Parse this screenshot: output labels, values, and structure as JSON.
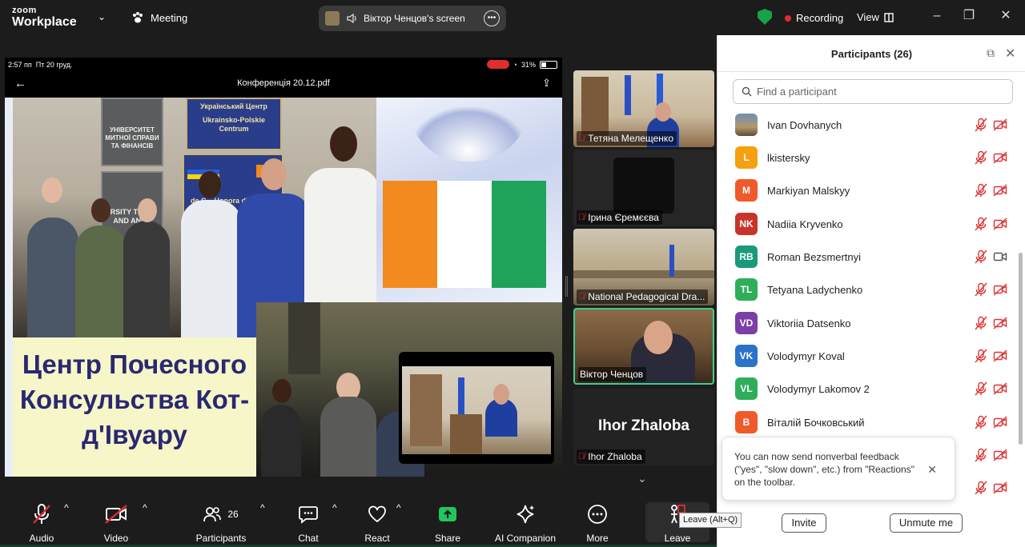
{
  "app": {
    "logo_line1": "zoom",
    "logo_line2": "Workplace",
    "meeting_label": "Meeting",
    "share_label": "Віктор Ченцов's screen",
    "recording_label": "Recording",
    "view_label": "View"
  },
  "shared_screen": {
    "status_time": "2:57 пп",
    "status_date": "Пт 20 груд.",
    "battery": "31%",
    "pdf_title": "Конференція 20.12.pdf",
    "plaque_line1": "Український Центр",
    "plaque_line2": "Ukrainsko-Polskie Centrum",
    "plaque_ua": "УНІВЕРСИТЕТ МИТНОЇ СПРАВИ ТА ФІНАНСІВ",
    "plaque_en": "RSITY TOMS AND ANCE",
    "plaque_honor": "de C... Honora d'Ivoire",
    "slide_text": "Центр Почесного Консульства Кот-д'Івуару",
    "flag_colors": [
      "#f28a1e",
      "#ffffff",
      "#1fa35a"
    ]
  },
  "video_tiles": [
    {
      "name": "Тетяна Мелещенко",
      "muted": true
    },
    {
      "name": "Ірина Єремєєва",
      "muted": true
    },
    {
      "name": "National Pedagogical Dra...",
      "muted": true
    },
    {
      "name": "Віктор Ченцов",
      "muted": false,
      "active": true
    },
    {
      "name": "Ihor Zhaloba",
      "muted": true,
      "camera_off": true
    }
  ],
  "participants_panel": {
    "title": "Participants (26)",
    "search_placeholder": "Find a participant",
    "participants": [
      {
        "name": "Ivan Dovhanych",
        "initials": "",
        "color": "photo",
        "cam_on": false
      },
      {
        "name": "lkistersky",
        "initials": "L",
        "color": "#f5a010",
        "cam_on": false
      },
      {
        "name": "Markiyan Malskyy",
        "initials": "M",
        "color": "#ef5a2a",
        "cam_on": false
      },
      {
        "name": "Nadiia Kryvenko",
        "initials": "NK",
        "color": "#c8342b",
        "cam_on": false
      },
      {
        "name": "Roman Bezsmertnyi",
        "initials": "RB",
        "color": "#1a9a7a",
        "cam_on": true
      },
      {
        "name": "Tetyana Ladychenko",
        "initials": "TL",
        "color": "#2fae5a",
        "cam_on": false
      },
      {
        "name": "Viktoriia Datsenko",
        "initials": "VD",
        "color": "#7b3fa8",
        "cam_on": false
      },
      {
        "name": "Volodymyr Koval",
        "initials": "VK",
        "color": "#2b72c9",
        "cam_on": false
      },
      {
        "name": "Volodymyr Lakomov 2",
        "initials": "VL",
        "color": "#2fae5a",
        "cam_on": false
      },
      {
        "name": "Віталій Бочковський",
        "initials": "B",
        "color": "#ef5a2a",
        "cam_on": false
      },
      {
        "name": "",
        "initials": "",
        "color": "",
        "cam_on": false
      },
      {
        "name": "",
        "initials": "",
        "color": "",
        "cam_on": false
      }
    ],
    "toast_text": "You can now send nonverbal feedback (\"yes\", \"slow down\", etc.) from \"Reactions\" on the toolbar.",
    "invite_label": "Invite",
    "unmute_label": "Unmute me"
  },
  "toolbar": {
    "audio": "Audio",
    "video": "Video",
    "participants": "Participants",
    "participants_count": "26",
    "chat": "Chat",
    "react": "React",
    "share": "Share",
    "ai_companion": "AI Companion",
    "more": "More",
    "leave": "Leave",
    "leave_tooltip": "Leave (Alt+Q)"
  }
}
